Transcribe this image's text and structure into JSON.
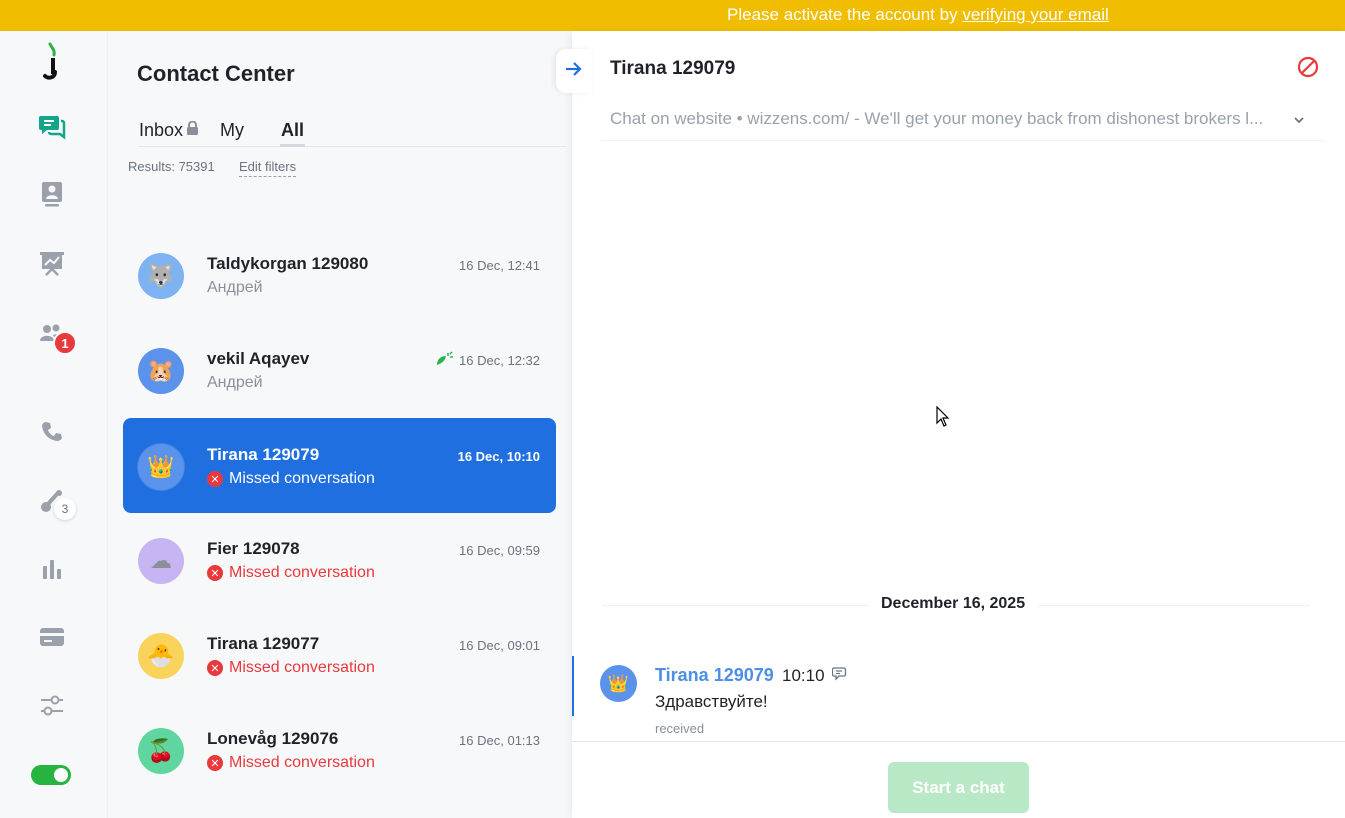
{
  "banner": {
    "text": "Please activate the account by ",
    "link": "verifying your email",
    "color": "#f0bd00"
  },
  "rail": {
    "items": [
      {
        "icon": "chats-icon",
        "active": true
      },
      {
        "icon": "contacts-icon"
      },
      {
        "icon": "reports-board-icon"
      },
      {
        "icon": "team-icon",
        "badge": "1"
      },
      {
        "icon": "phone-icon"
      },
      {
        "icon": "integrations-icon",
        "badge": "3"
      },
      {
        "icon": "analytics-icon"
      },
      {
        "icon": "billing-card-icon"
      },
      {
        "icon": "settings-sliders-icon"
      }
    ],
    "team_badge": "1",
    "integrations_badge": "3",
    "status_toggle_on": true
  },
  "list": {
    "title": "Contact Center",
    "tabs": {
      "inbox": "Inbox",
      "my": "My",
      "all": "All"
    },
    "results": "Results: 75391",
    "edit_filters": "Edit filters",
    "conversations": [
      {
        "name": "Taldykorgan 129080",
        "time": "16 Dec, 12:41",
        "sub": "Андрей",
        "avatar": "🐺",
        "avatar_color": "#7fb2f0",
        "missed": false
      },
      {
        "name": "vekil Aqayev",
        "time": "16 Dec, 12:32",
        "sub": "Андрей",
        "avatar": "🐹",
        "avatar_color": "#5b93ec",
        "missed": false
      },
      {
        "name": "Tirana 129079",
        "time": "16 Dec, 10:10",
        "sub": "Missed conversation",
        "avatar": "👑",
        "avatar_color": "#5b93ec",
        "missed": true,
        "selected": true
      },
      {
        "name": "Fier 129078",
        "time": "16 Dec, 09:59",
        "sub": "Missed conversation",
        "avatar": "☁",
        "avatar_color": "#c6b5f2",
        "missed": true
      },
      {
        "name": "Tirana 129077",
        "time": "16 Dec, 09:01",
        "sub": "Missed conversation",
        "avatar": "🐣",
        "avatar_color": "#f9d35b",
        "missed": true
      },
      {
        "name": "Lonevåg 129076",
        "time": "16 Dec, 01:13",
        "sub": "Missed conversation",
        "avatar": "🍒",
        "avatar_color": "#5fd6a0",
        "missed": true
      }
    ]
  },
  "detail": {
    "title": "Tirana 129079",
    "source": "Chat on website • wizzens.com/ - We'll get your money back from dishonest brokers l...",
    "date_separator": "December 16, 2025",
    "message": {
      "author": "Tirana 129079",
      "time": "10:10",
      "text": "Здравствуйте!",
      "status": "received",
      "avatar": "👑"
    },
    "start_chat": "Start a chat"
  }
}
